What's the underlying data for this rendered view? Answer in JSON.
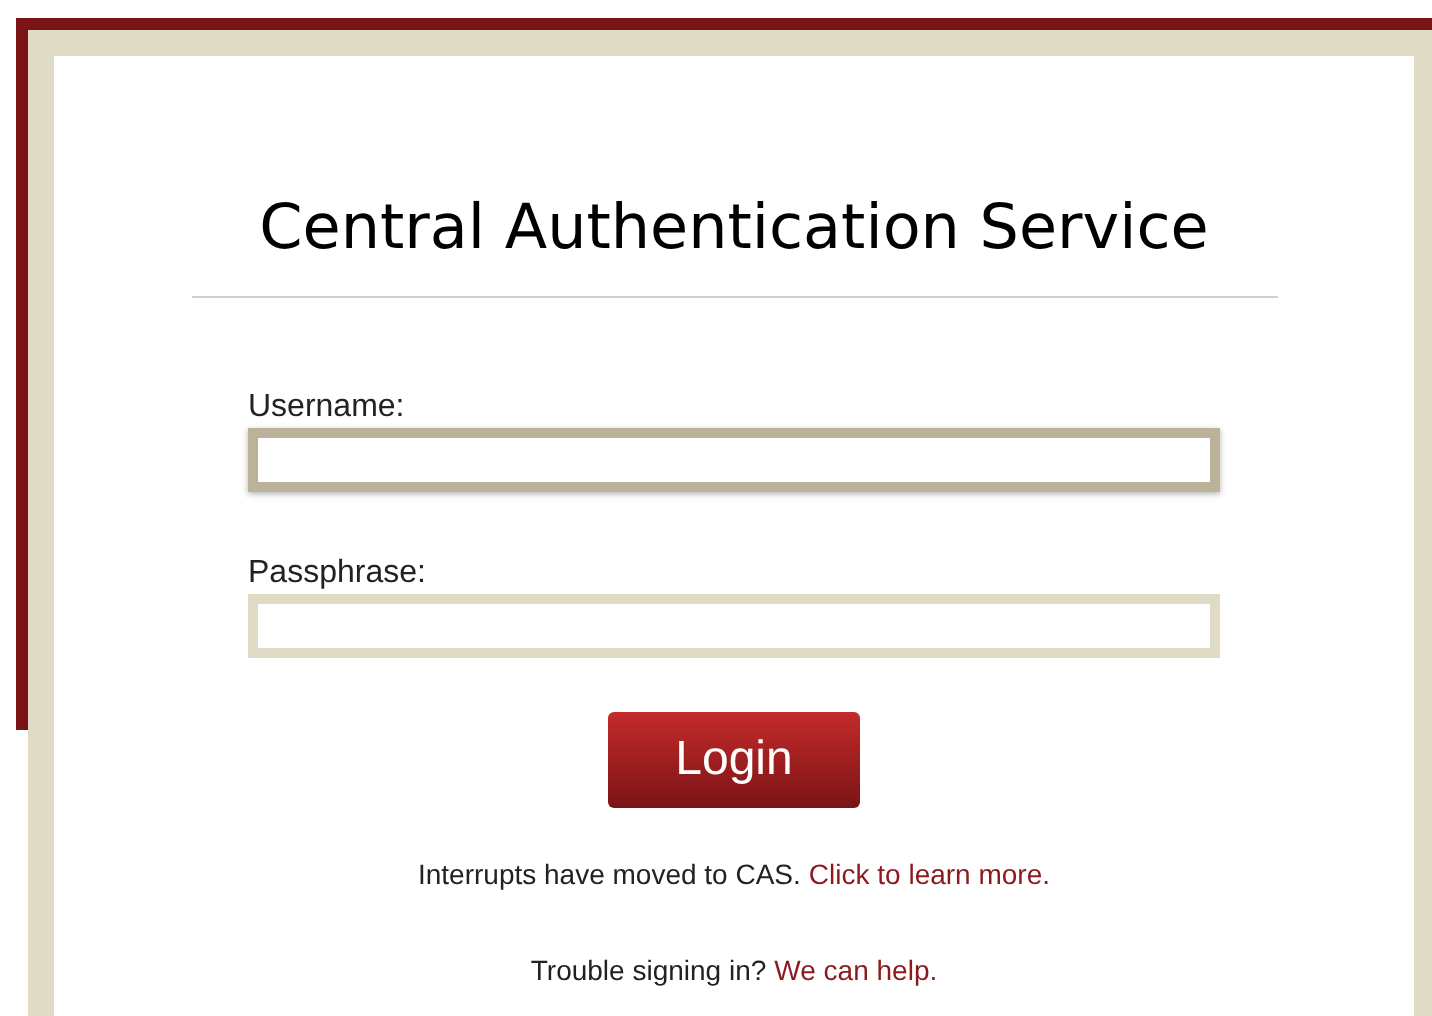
{
  "title": "Central Authentication Service",
  "fields": [
    {
      "label": "Username:",
      "focused": true
    },
    {
      "label": "Passphrase:",
      "focused": false
    }
  ],
  "login_button": "Login",
  "notices": [
    {
      "text": "Interrupts have moved to CAS.",
      "link": "Click to learn more."
    },
    {
      "text": "Trouble signing in?",
      "link": "We can help."
    }
  ]
}
